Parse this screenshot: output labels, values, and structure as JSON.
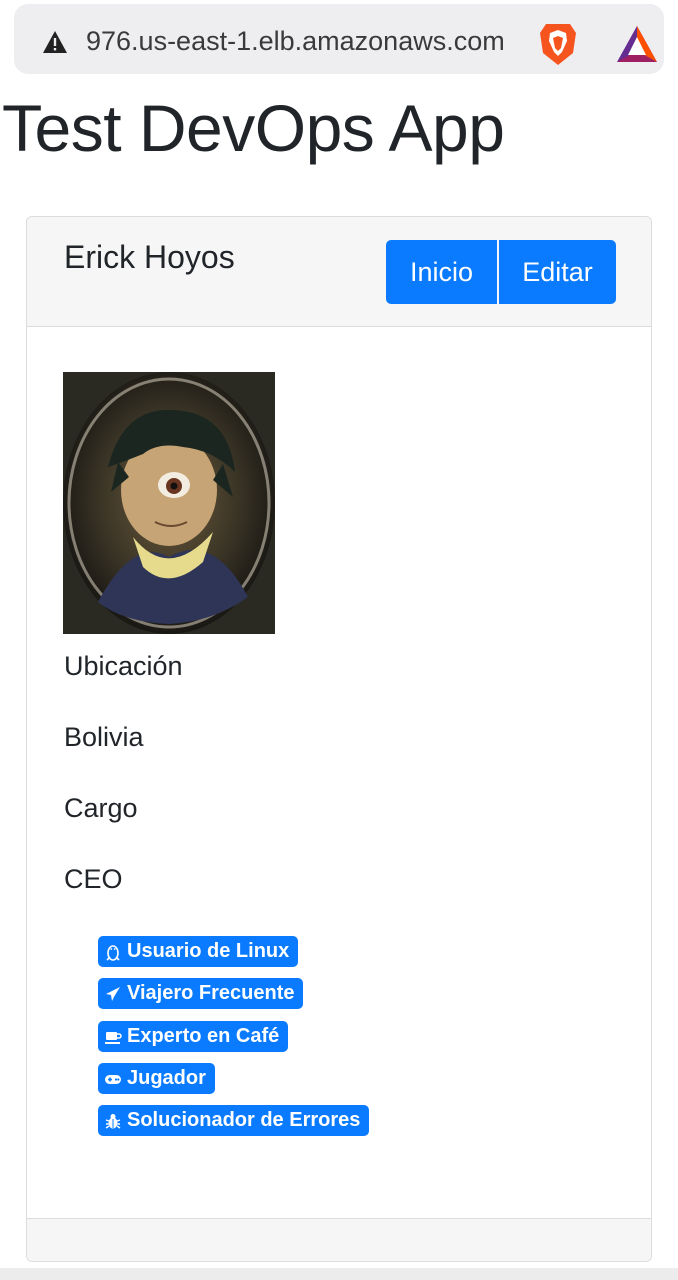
{
  "browser": {
    "url": "976.us-east-1.elb.amazonaws.com",
    "icons": [
      "warning-icon",
      "brave-lion-icon",
      "bat-triangle-icon"
    ]
  },
  "app": {
    "title": "Test DevOps App"
  },
  "profile": {
    "name": "Erick Hoyos",
    "buttons": {
      "home": "Inicio",
      "edit": "Editar"
    },
    "avatar_alt": "avatar",
    "location_label": "Ubicación",
    "location_value": "Bolivia",
    "role_label": "Cargo",
    "role_value": "CEO",
    "badges": [
      {
        "icon": "linux-icon",
        "label": "Usuario de Linux"
      },
      {
        "icon": "plane-icon",
        "label": "Viajero Frecuente"
      },
      {
        "icon": "coffee-icon",
        "label": "Experto en Café"
      },
      {
        "icon": "gamepad-icon",
        "label": "Jugador"
      },
      {
        "icon": "bug-icon",
        "label": "Solucionador de Errores"
      }
    ]
  },
  "colors": {
    "primary": "#0a7bff",
    "header_bg": "#f6f6f6",
    "text": "#212529"
  }
}
